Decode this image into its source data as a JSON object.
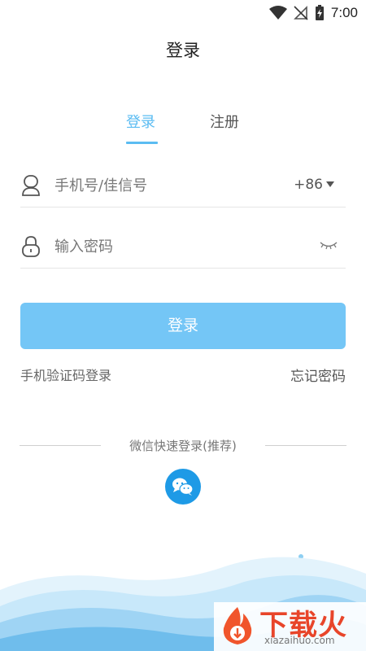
{
  "status_bar": {
    "time": "7:00",
    "icons": [
      "wifi-icon",
      "no-signal-icon",
      "battery-charging-icon"
    ]
  },
  "header": {
    "title": "登录"
  },
  "tabs": [
    {
      "label": "登录",
      "active": true
    },
    {
      "label": "注册",
      "active": false
    }
  ],
  "phone_field": {
    "placeholder": "手机号/佳信号",
    "value": "",
    "country_code": "+86",
    "icon": "user-icon"
  },
  "password_field": {
    "placeholder": "输入密码",
    "value": "",
    "icon": "lock-icon",
    "toggle_icon": "eye-closed-icon"
  },
  "login_button": {
    "label": "登录"
  },
  "links": {
    "sms_login": "手机验证码登录",
    "forgot_password": "忘记密码"
  },
  "wechat": {
    "label": "微信快速登录(推荐)",
    "icon": "wechat-icon"
  },
  "watermark": {
    "text": "下载火",
    "domain": "xiazaihuo.com"
  },
  "colors": {
    "accent": "#5bbcf2",
    "button": "#74c6f6",
    "wechat": "#1e9ae6",
    "watermark": "#e8452a"
  }
}
